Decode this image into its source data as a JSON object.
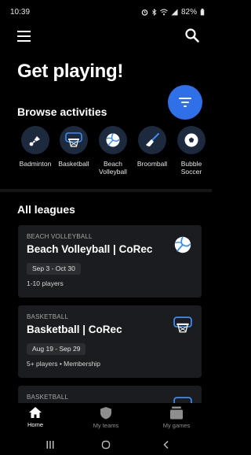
{
  "status": {
    "time": "10:39",
    "battery": "82%"
  },
  "header": {
    "title": "Get playing!"
  },
  "browse": {
    "title": "Browse activities",
    "activities": [
      {
        "label": "Badminton",
        "icon": "shuttlecock-icon"
      },
      {
        "label": "Basketball",
        "icon": "basketball-hoop-icon"
      },
      {
        "label": "Beach\nVolleyball",
        "icon": "volleyball-icon"
      },
      {
        "label": "Broomball",
        "icon": "broom-icon"
      },
      {
        "label": "Bubble\nSoccer",
        "icon": "soccer-ball-icon"
      }
    ]
  },
  "leagues": {
    "title": "All leagues",
    "items": [
      {
        "sport": "BEACH VOLLEYBALL",
        "name": "Beach Volleyball | CoRec",
        "dates": "Sep 3 - Oct 30",
        "meta": "1-10 players",
        "icon": "volleyball-icon"
      },
      {
        "sport": "BASKETBALL",
        "name": "Basketball | CoRec",
        "dates": "Aug 19 - Sep 29",
        "meta": "5+ players • Membership",
        "icon": "basketball-hoop-icon"
      },
      {
        "sport": "BASKETBALL",
        "icon": "basketball-hoop-icon"
      }
    ]
  },
  "nav": {
    "home": "Home",
    "teams": "My teams",
    "games": "My games"
  },
  "colors": {
    "accent": "#2f6fe8",
    "card": "#1b1c1f",
    "activity_circle": "#1d2a3e",
    "icon_blue": "#3d8cf5"
  }
}
